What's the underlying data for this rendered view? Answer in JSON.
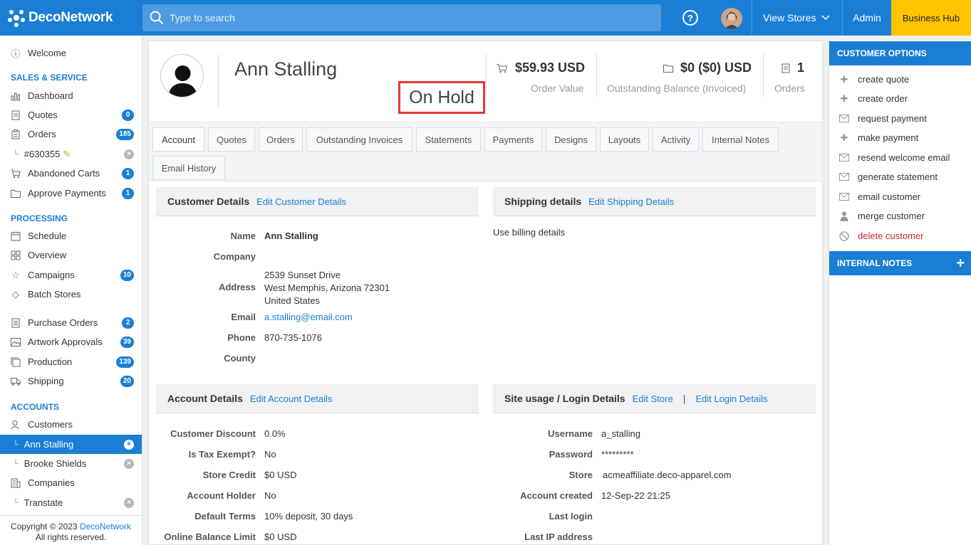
{
  "topbar": {
    "brand": "DecoNetwork",
    "search_placeholder": "Type to search",
    "help": "?",
    "view_stores": "View Stores",
    "admin": "Admin",
    "business_hub": "Business Hub"
  },
  "sidebar": {
    "welcome": "Welcome",
    "sales_heading": "SALES & SERVICE",
    "dashboard": "Dashboard",
    "quotes": "Quotes",
    "quotes_count": "0",
    "orders": "Orders",
    "orders_count": "185",
    "order_ref": "#630355",
    "abandoned_carts": "Abandoned Carts",
    "abandoned_count": "1",
    "approve_payments": "Approve Payments",
    "approve_count": "1",
    "processing_heading": "PROCESSING",
    "schedule": "Schedule",
    "overview": "Overview",
    "campaigns": "Campaigns",
    "campaigns_count": "10",
    "batch_stores": "Batch Stores",
    "purchase_orders": "Purchase Orders",
    "po_count": "2",
    "artwork_approvals": "Artwork Approvals",
    "artwork_count": "39",
    "production": "Production",
    "production_count": "139",
    "shipping": "Shipping",
    "shipping_count": "20",
    "accounts_heading": "ACCOUNTS",
    "customers": "Customers",
    "ann_stalling": "Ann Stalling",
    "brooke_shields": "Brooke Shields",
    "companies": "Companies",
    "transtate": "Transtate",
    "copyright_prefix": "Copyright © 2023",
    "copyright_link": "DecoNetwork",
    "rights": "All rights reserved."
  },
  "customer": {
    "name": "Ann Stalling",
    "status": "On Hold",
    "order_value": "$59.93 USD",
    "order_value_label": "Order Value",
    "outstanding": "$0 ($0) USD",
    "outstanding_label": "Outstanding Balance (Invoiced)",
    "orders_count": "1",
    "orders_label": "Orders"
  },
  "tabs": [
    "Account",
    "Quotes",
    "Orders",
    "Outstanding Invoices",
    "Statements",
    "Payments",
    "Designs",
    "Layouts",
    "Activity",
    "Internal Notes",
    "Email History"
  ],
  "customer_details": {
    "title": "Customer Details",
    "edit": "Edit Customer Details",
    "name_label": "Name",
    "name": "Ann Stalling",
    "company_label": "Company",
    "address_label": "Address",
    "address_line1": "2539 Sunset Drive",
    "address_line2": "West Memphis, Arizona 72301",
    "address_line3": "United States",
    "email_label": "Email",
    "email": "a.stalling@email.com",
    "phone_label": "Phone",
    "phone": "870-735-1076",
    "county_label": "County"
  },
  "shipping_details": {
    "title": "Shipping details",
    "edit": "Edit Shipping Details",
    "note": "Use billing details"
  },
  "account_details": {
    "title": "Account Details",
    "edit": "Edit Account Details",
    "discount_label": "Customer Discount",
    "discount": "0.0%",
    "tax_label": "Is Tax Exempt?",
    "tax": "No",
    "credit_label": "Store Credit",
    "credit": "$0 USD",
    "holder_label": "Account Holder",
    "holder": "No",
    "terms_label": "Default Terms",
    "terms": "10% deposit, 30 days",
    "limit_label": "Online Balance Limit",
    "limit": "$0 USD"
  },
  "site_usage": {
    "title": "Site usage / Login Details",
    "edit_store": "Edit Store",
    "separator": "|",
    "edit_login": "Edit Login Details",
    "username_label": "Username",
    "username": "a_stalling",
    "password_label": "Password",
    "password": "*********",
    "store_label": "Store",
    "store": "acmeaffiliate.deco-apparel.com",
    "created_label": "Account created",
    "created": "12-Sep-22 21:25",
    "last_login_label": "Last login",
    "last_ip_label": "Last IP address"
  },
  "right_panel": {
    "options_heading": "CUSTOMER OPTIONS",
    "create_quote": "create quote",
    "create_order": "create order",
    "request_payment": "request payment",
    "make_payment": "make payment",
    "resend_welcome": "resend welcome email",
    "generate_statement": "generate statement",
    "email_customer": "email customer",
    "merge_customer": "merge customer",
    "delete_customer": "delete customer",
    "notes_heading": "INTERNAL NOTES"
  }
}
